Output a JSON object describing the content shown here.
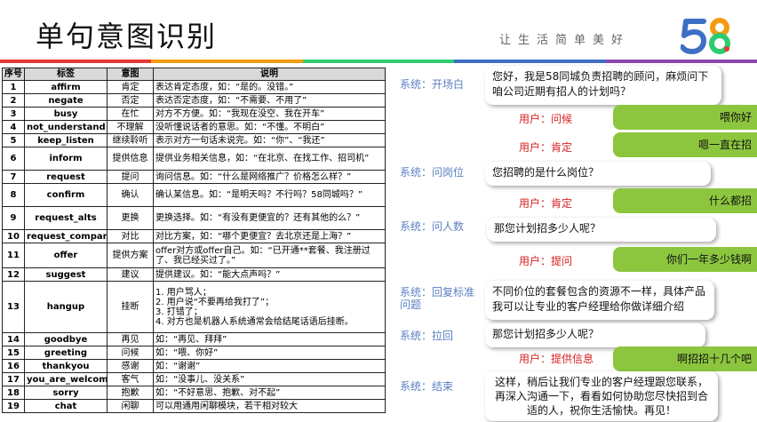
{
  "header": {
    "title": "单句意图识别",
    "slogan": "让生活简单美好",
    "logo_text": "58",
    "stripe_colors": [
      "#e53935",
      "#f39c12",
      "#2ecc71",
      "#3d6fc4",
      "#8e44ad"
    ]
  },
  "table": {
    "headers": [
      "序号",
      "标签",
      "意图",
      "说明"
    ],
    "rows": [
      {
        "no": "1",
        "tag": "affirm",
        "intent": "肯定",
        "desc": "表达肯定态度，如：“是的。没错。”"
      },
      {
        "no": "2",
        "tag": "negate",
        "intent": "否定",
        "desc": "表达否定态度，如：“不需要、不用了”"
      },
      {
        "no": "3",
        "tag": "busy",
        "intent": "在忙",
        "desc": "对方不方便。如：“我现在没空、我在开车”"
      },
      {
        "no": "4",
        "tag": "not_understand",
        "intent": "不理解",
        "desc": "没听懂说话者的意思。如：“不懂。不明白”"
      },
      {
        "no": "5",
        "tag": "keep_listen",
        "intent": "继续聆听",
        "desc": "表示对方一句话未说完。如：“你”、“我还”"
      },
      {
        "no": "6",
        "tag": "inform",
        "intent": "提供信息",
        "desc": "提供业务相关信息，如：“在北京、在找工作、招司机”"
      },
      {
        "no": "7",
        "tag": "request",
        "intent": "提问",
        "desc": "询问信息。如：“什么是网络推广？价格怎么样？”"
      },
      {
        "no": "8",
        "tag": "confirm",
        "intent": "确认",
        "desc": "确认某信息。如：“是明天吗？不行吗？58同城吗？”"
      },
      {
        "no": "9",
        "tag": "request_alts",
        "intent": "更换",
        "desc": "更换选择。如：“有没有更便宜的？还有其他的么？”"
      },
      {
        "no": "10",
        "tag": "request_compare",
        "intent": "对比",
        "desc": "对比方案，如：“哪个更便宜？去北京还是上海？”"
      },
      {
        "no": "11",
        "tag": "offer",
        "intent": "提供方案",
        "desc": "offer对方或offer自己。如：“已开通**套餐、我注册过了、我已经买过了。”"
      },
      {
        "no": "12",
        "tag": "suggest",
        "intent": "建议",
        "desc": "提供建议。如：“能大点声吗？”"
      },
      {
        "no": "13",
        "tag": "hangup",
        "intent": "挂断",
        "desc_lines": [
          "1. 用户骂人；",
          "2. 用户说“不要再给我打了”；",
          "3. 打错了；",
          "4. 对方也是机器人系统通常会给结尾话语后挂断。"
        ]
      },
      {
        "no": "14",
        "tag": "goodbye",
        "intent": "再见",
        "desc": "如：“再见、拜拜”"
      },
      {
        "no": "15",
        "tag": "greeting",
        "intent": "问候",
        "desc": "如：“喂、你好”"
      },
      {
        "no": "16",
        "tag": "thankyou",
        "intent": "感谢",
        "desc": "如：“谢谢”"
      },
      {
        "no": "17",
        "tag": "you_are_welcome",
        "intent": "客气",
        "desc": "如：“没事儿、没关系”"
      },
      {
        "no": "18",
        "tag": "sorry",
        "intent": "抱歉",
        "desc": "如：“不好意思、抱歉、对不起”"
      },
      {
        "no": "19",
        "tag": "chat",
        "intent": "闲聊",
        "desc": "可以用通用闲聊模块，若干相对较大"
      }
    ]
  },
  "dialogue": {
    "roles": {
      "opening": "系统：开场白",
      "ask_position": "系统：问岗位",
      "ask_count": "系统：问人数",
      "reply_question": "系统：回复标准问题",
      "pull_back": "系统：拉回",
      "ending": "系统：结束"
    },
    "bot_messages": {
      "opening": "您好，我是58同城负责招聘的顾问，麻烦问下咱公司近期有招人的计划吗？",
      "ask_position": "您招聘的是什么岗位？",
      "ask_count": "那您计划招多少人呢？",
      "reply_question": "不同价位的套餐包含的资源不一样，具体产品我可以让专业的客户经理给你做详细介绍",
      "pull_back": "那您计划招多少人呢？",
      "ending": "这样，稍后让我们专业的客户经理跟您联系，再深入沟通一下，看看如何协助您尽快招到合适的人，祝你生活愉快。再见！"
    },
    "user_turns": [
      {
        "label": "用户：问候",
        "text": "喂你好"
      },
      {
        "label": "用户：肯定",
        "text": "嗯一直在招"
      },
      {
        "label": "用户：肯定",
        "text": "什么都招"
      },
      {
        "label": "用户：提问",
        "text": "你们一年多少钱啊"
      },
      {
        "label": "用户：提供信息",
        "text": "啊招招十几个吧"
      }
    ]
  }
}
